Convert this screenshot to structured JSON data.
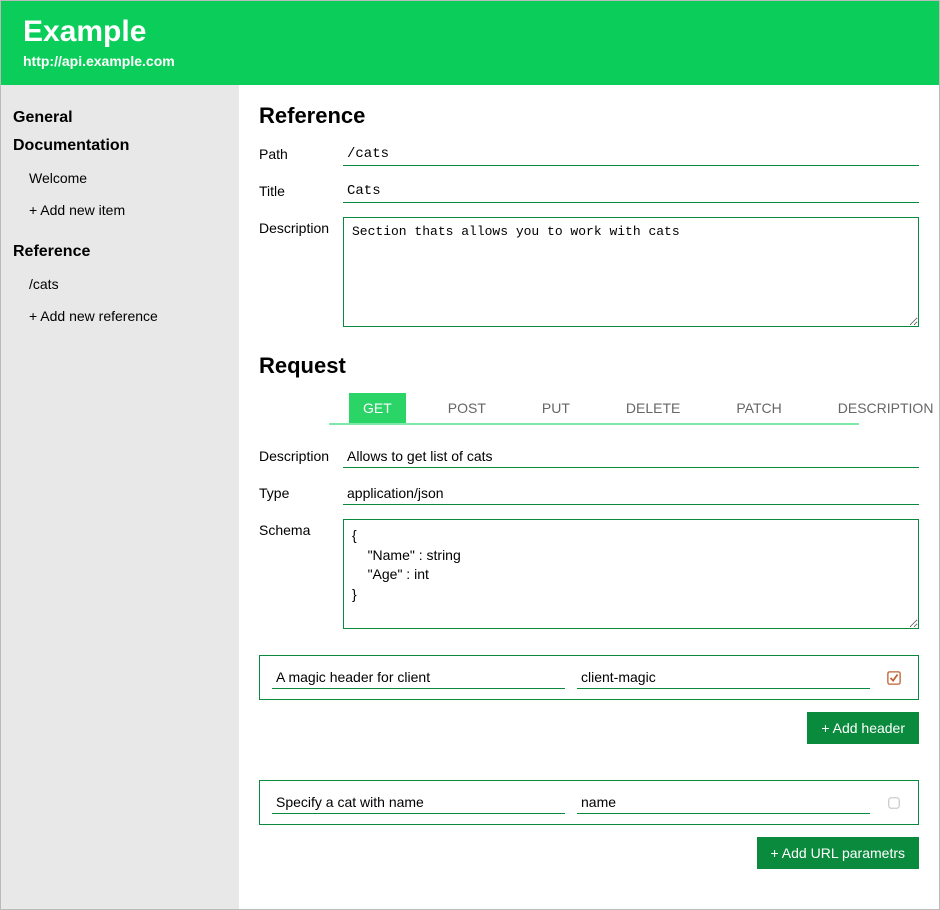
{
  "header": {
    "title": "Example",
    "subtitle": "http://api.example.com"
  },
  "sidebar": {
    "sections": [
      {
        "title": "General",
        "items": []
      },
      {
        "title": "Documentation",
        "items": [
          {
            "label": "Welcome"
          },
          {
            "label": "+ Add new item"
          }
        ]
      },
      {
        "title": "Reference",
        "items": [
          {
            "label": "/cats"
          },
          {
            "label": "+ Add new reference"
          }
        ]
      }
    ]
  },
  "reference": {
    "heading": "Reference",
    "labels": {
      "path": "Path",
      "title": "Title",
      "description": "Description"
    },
    "path": "/cats",
    "title": "Cats",
    "description": "Section thats allows you to work with cats"
  },
  "request": {
    "heading": "Request",
    "tabs": [
      {
        "label": "GET",
        "active": true
      },
      {
        "label": "POST",
        "active": false
      },
      {
        "label": "PUT",
        "active": false
      },
      {
        "label": "DELETE",
        "active": false
      },
      {
        "label": "PATCH",
        "active": false
      },
      {
        "label": "DESCRIPTION",
        "active": false
      }
    ],
    "labels": {
      "description": "Description",
      "type": "Type",
      "schema": "Schema"
    },
    "description": "Allows to get list of cats",
    "type": "application/json",
    "schema": "{\n    \"Name\" : string\n    \"Age\" : int\n}",
    "headers": [
      {
        "desc": "A magic header for client",
        "name": "client-magic",
        "required": true
      }
    ],
    "urlparams": [
      {
        "desc": "Specify a cat with name",
        "name": "name",
        "required": false
      }
    ],
    "buttons": {
      "add_header": "+ Add header",
      "add_url_param": "+ Add URL parametrs"
    }
  }
}
